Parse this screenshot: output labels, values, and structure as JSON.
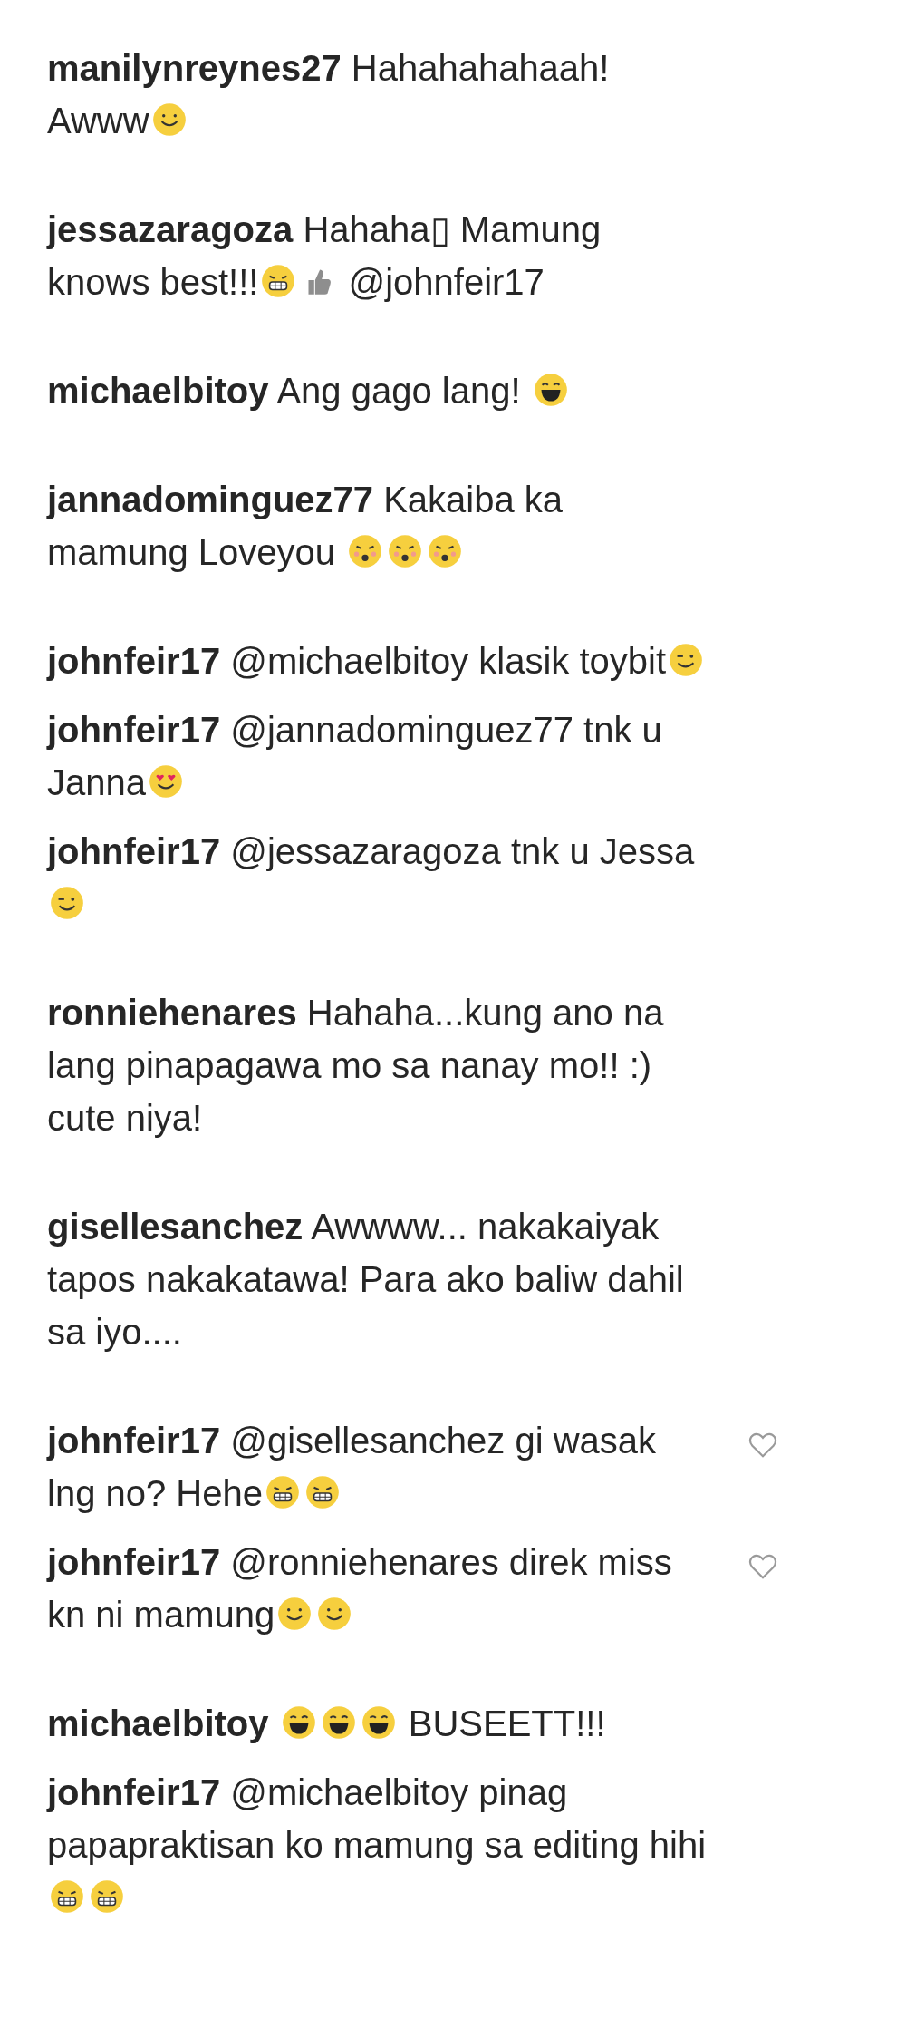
{
  "threads": [
    {
      "comments": [
        {
          "username": "manilynreynes27",
          "parts": [
            {
              "kind": "text",
              "text": "Hahahahahaah! Awww"
            },
            {
              "kind": "smile"
            }
          ]
        }
      ]
    },
    {
      "comments": [
        {
          "username": "jessazaragoza",
          "parts": [
            {
              "kind": "text",
              "text": "Hahaha▯ Mamung knows best!!!"
            },
            {
              "kind": "grin"
            },
            {
              "kind": "thumbs"
            },
            {
              "kind": "text",
              "text": " @johnfeir17"
            }
          ]
        }
      ]
    },
    {
      "comments": [
        {
          "username": "michaelbitoy",
          "parts": [
            {
              "kind": "text",
              "text": "Ang gago lang! "
            },
            {
              "kind": "laugh"
            }
          ]
        }
      ]
    },
    {
      "comments": [
        {
          "username": "jannadominguez77",
          "parts": [
            {
              "kind": "text",
              "text": "Kakaiba ka mamung Loveyou "
            },
            {
              "kind": "kiss"
            },
            {
              "kind": "kiss"
            },
            {
              "kind": "kiss"
            }
          ]
        }
      ]
    },
    {
      "comments": [
        {
          "username": "johnfeir17",
          "parts": [
            {
              "kind": "text",
              "text": "@michaelbitoy klasik toybit"
            },
            {
              "kind": "wink"
            }
          ]
        },
        {
          "username": "johnfeir17",
          "parts": [
            {
              "kind": "text",
              "text": "@jannadominguez77 tnk u Janna"
            },
            {
              "kind": "hearteyes"
            }
          ]
        },
        {
          "username": "johnfeir17",
          "parts": [
            {
              "kind": "text",
              "text": "@jessazaragoza tnk u Jessa"
            },
            {
              "kind": "wink"
            }
          ]
        }
      ]
    },
    {
      "comments": [
        {
          "username": "ronniehenares",
          "parts": [
            {
              "kind": "text",
              "text": "Hahaha...kung ano na lang pinapagawa mo sa nanay mo!! :) cute niya!"
            }
          ]
        }
      ]
    },
    {
      "comments": [
        {
          "username": "gisellesanchez",
          "parts": [
            {
              "kind": "text",
              "text": "Awwww... nakakaiyak tapos nakakatawa! Para ako baliw dahil sa iyo...."
            }
          ]
        }
      ]
    },
    {
      "comments": [
        {
          "username": "johnfeir17",
          "like_button": {
            "liked": false
          },
          "parts": [
            {
              "kind": "text",
              "text": "@gisellesanchez gi wasak lng no? Hehe"
            },
            {
              "kind": "grin"
            },
            {
              "kind": "grin"
            }
          ]
        },
        {
          "username": "johnfeir17",
          "like_button": {
            "liked": false
          },
          "parts": [
            {
              "kind": "text",
              "text": "@ronniehenares direk miss kn ni mamung"
            },
            {
              "kind": "smile"
            },
            {
              "kind": "smile"
            }
          ]
        }
      ]
    },
    {
      "comments": [
        {
          "username": "michaelbitoy",
          "parts": [
            {
              "kind": "laugh"
            },
            {
              "kind": "laugh"
            },
            {
              "kind": "laugh"
            },
            {
              "kind": "text",
              "text": " BUSEETT!!!"
            }
          ]
        },
        {
          "username": "johnfeir17",
          "parts": [
            {
              "kind": "text",
              "text": "@michaelbitoy pinag papapraktisan ko mamung sa editing hihi"
            },
            {
              "kind": "grin"
            },
            {
              "kind": "grin"
            }
          ]
        }
      ]
    }
  ]
}
